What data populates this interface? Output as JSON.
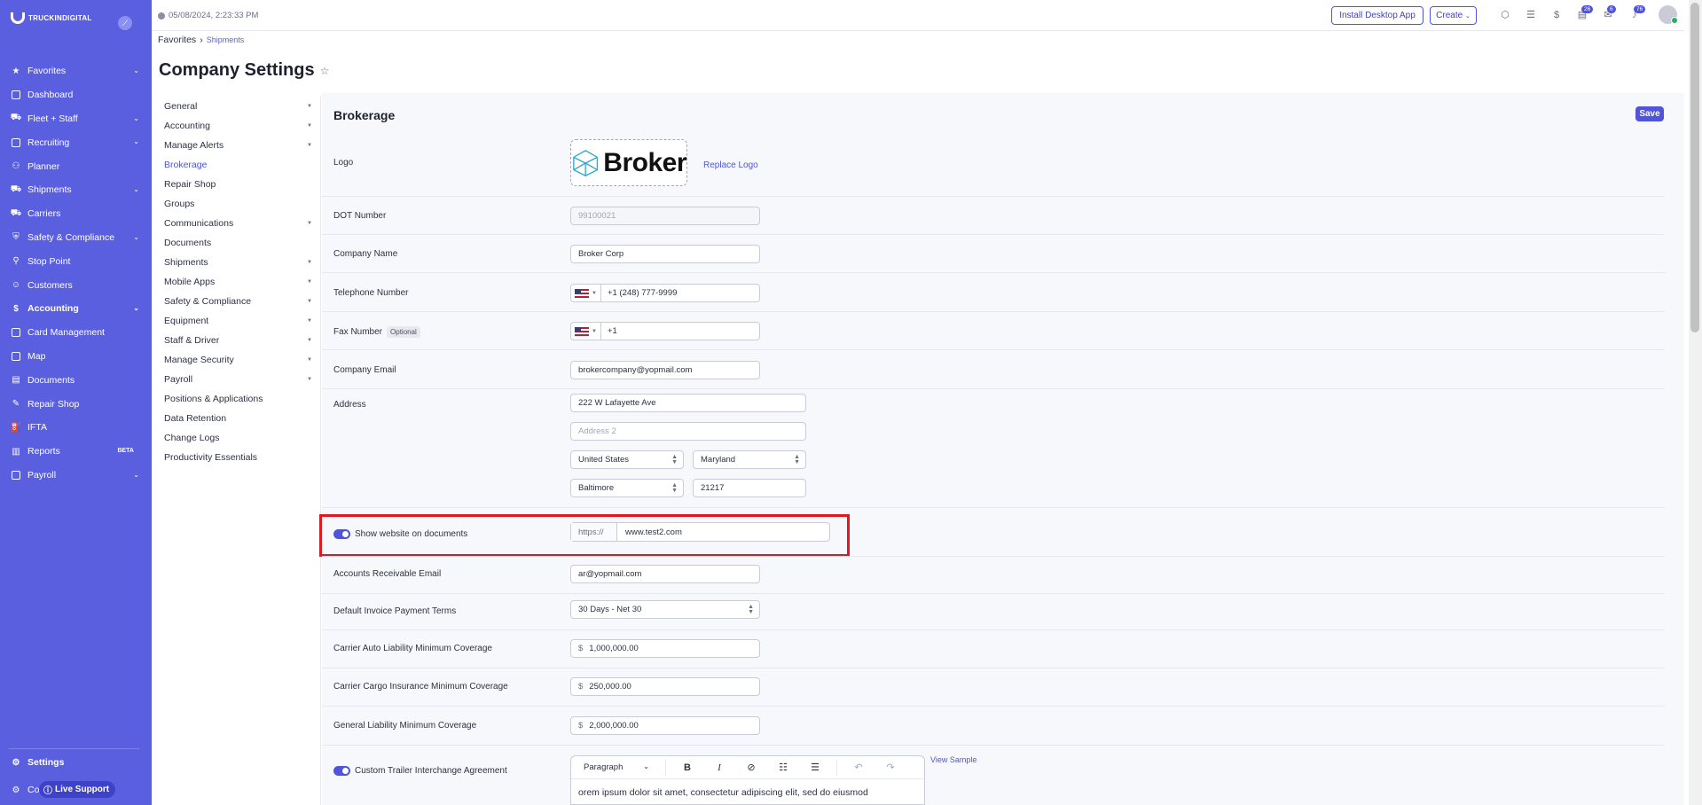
{
  "brand": {
    "name": "TRUCKINDIGITAL"
  },
  "sidebar": {
    "items": [
      {
        "label": "Favorites",
        "icon": "star-icon",
        "chevron": true
      },
      {
        "label": "Dashboard",
        "icon": "dashboard-icon",
        "chevron": false
      },
      {
        "label": "Fleet + Staff",
        "icon": "fleet-icon",
        "chevron": true
      },
      {
        "label": "Recruiting",
        "icon": "recruiting-icon",
        "chevron": true
      },
      {
        "label": "Planner",
        "icon": "planner-icon",
        "chevron": false
      },
      {
        "label": "Shipments",
        "icon": "truck-icon",
        "chevron": true
      },
      {
        "label": "Carriers",
        "icon": "carriers-icon",
        "chevron": false
      },
      {
        "label": "Safety & Compliance",
        "icon": "shield-icon",
        "chevron": true
      },
      {
        "label": "Stop Point",
        "icon": "pin-icon",
        "chevron": false
      },
      {
        "label": "Customers",
        "icon": "customers-icon",
        "chevron": false
      },
      {
        "label": "Accounting",
        "icon": "dollar-icon",
        "chevron": true
      },
      {
        "label": "Card Management",
        "icon": "card-icon",
        "chevron": false
      },
      {
        "label": "Map",
        "icon": "map-icon",
        "chevron": false
      },
      {
        "label": "Documents",
        "icon": "document-icon",
        "chevron": false
      },
      {
        "label": "Repair Shop",
        "icon": "wrench-icon",
        "chevron": false
      },
      {
        "label": "IFTA",
        "icon": "fuel-icon",
        "chevron": false
      },
      {
        "label": "Reports",
        "icon": "reports-icon",
        "badge": "BETA"
      },
      {
        "label": "Payroll",
        "icon": "payroll-icon",
        "chevron": true
      }
    ],
    "settings_label": "Settings",
    "co_label": "Co",
    "live_support_label": "Live Support"
  },
  "topbar": {
    "datetime": "05/08/2024, 2:23:33 PM",
    "install_label": "Install Desktop App",
    "create_label": "Create",
    "badges": {
      "tasks": "26",
      "messages": "6",
      "notifications": "76"
    }
  },
  "breadcrumb": {
    "root": "Favorites",
    "current": "Shipments"
  },
  "page_title": "Company Settings",
  "submenu": [
    {
      "label": "General",
      "chevron": true
    },
    {
      "label": "Accounting",
      "chevron": true
    },
    {
      "label": "Manage Alerts",
      "chevron": true
    },
    {
      "label": "Brokerage",
      "chevron": false,
      "active": true
    },
    {
      "label": "Repair Shop",
      "chevron": false
    },
    {
      "label": "Groups",
      "chevron": false
    },
    {
      "label": "Communications",
      "chevron": true
    },
    {
      "label": "Documents",
      "chevron": false
    },
    {
      "label": "Shipments",
      "chevron": true
    },
    {
      "label": "Mobile Apps",
      "chevron": true
    },
    {
      "label": "Safety & Compliance",
      "chevron": true
    },
    {
      "label": "Equipment",
      "chevron": true
    },
    {
      "label": "Staff & Driver",
      "chevron": true
    },
    {
      "label": "Manage Security",
      "chevron": true
    },
    {
      "label": "Payroll",
      "chevron": true
    },
    {
      "label": "Positions & Applications",
      "chevron": false
    },
    {
      "label": "Data Retention",
      "chevron": false
    },
    {
      "label": "Change Logs",
      "chevron": false
    },
    {
      "label": "Productivity Essentials",
      "chevron": false
    }
  ],
  "form": {
    "section_title": "Brokerage",
    "save_label": "Save",
    "logo": {
      "label": "Logo",
      "logo_text": "Broker",
      "replace_label": "Replace Logo"
    },
    "dot": {
      "label": "DOT Number",
      "value": "99100021"
    },
    "company_name": {
      "label": "Company Name",
      "value": "Broker Corp"
    },
    "telephone": {
      "label": "Telephone Number",
      "value": "+1 (248) 777-9999"
    },
    "fax": {
      "label": "Fax Number",
      "optional_tag": "Optional",
      "value": "+1"
    },
    "email": {
      "label": "Company Email",
      "value": "brokercompany@yopmail.com"
    },
    "address": {
      "label": "Address",
      "line1": "222 W Lafayette Ave",
      "line2_placeholder": "Address 2",
      "country": "United States",
      "state": "Maryland",
      "city": "Baltimore",
      "zip": "21217"
    },
    "website": {
      "label": "Show website on documents",
      "enabled": true,
      "prefix": "https://",
      "value": "www.test2.com"
    },
    "ar_email": {
      "label": "Accounts Receivable Email",
      "value": "ar@yopmail.com"
    },
    "payment_terms": {
      "label": "Default Invoice Payment Terms",
      "value": "30 Days - Net 30"
    },
    "auto_liability": {
      "label": "Carrier Auto Liability Minimum Coverage",
      "currency": "$",
      "value": "1,000,000.00"
    },
    "cargo_insurance": {
      "label": "Carrier Cargo Insurance Minimum Coverage",
      "currency": "$",
      "value": "250,000.00"
    },
    "general_liability": {
      "label": "General Liability Minimum Coverage",
      "currency": "$",
      "value": "2,000,000.00"
    },
    "trailer_agreement": {
      "label": "Custom Trailer Interchange Agreement",
      "enabled": true,
      "view_sample_label": "View Sample",
      "paragraph_label": "Paragraph",
      "body_text": "orem ipsum dolor sit amet, consectetur adipiscing elit, sed do eiusmod"
    }
  },
  "colors": {
    "sidebar": "#5a5fe0",
    "accent": "#4f54d8",
    "highlight": "#e0191f"
  }
}
